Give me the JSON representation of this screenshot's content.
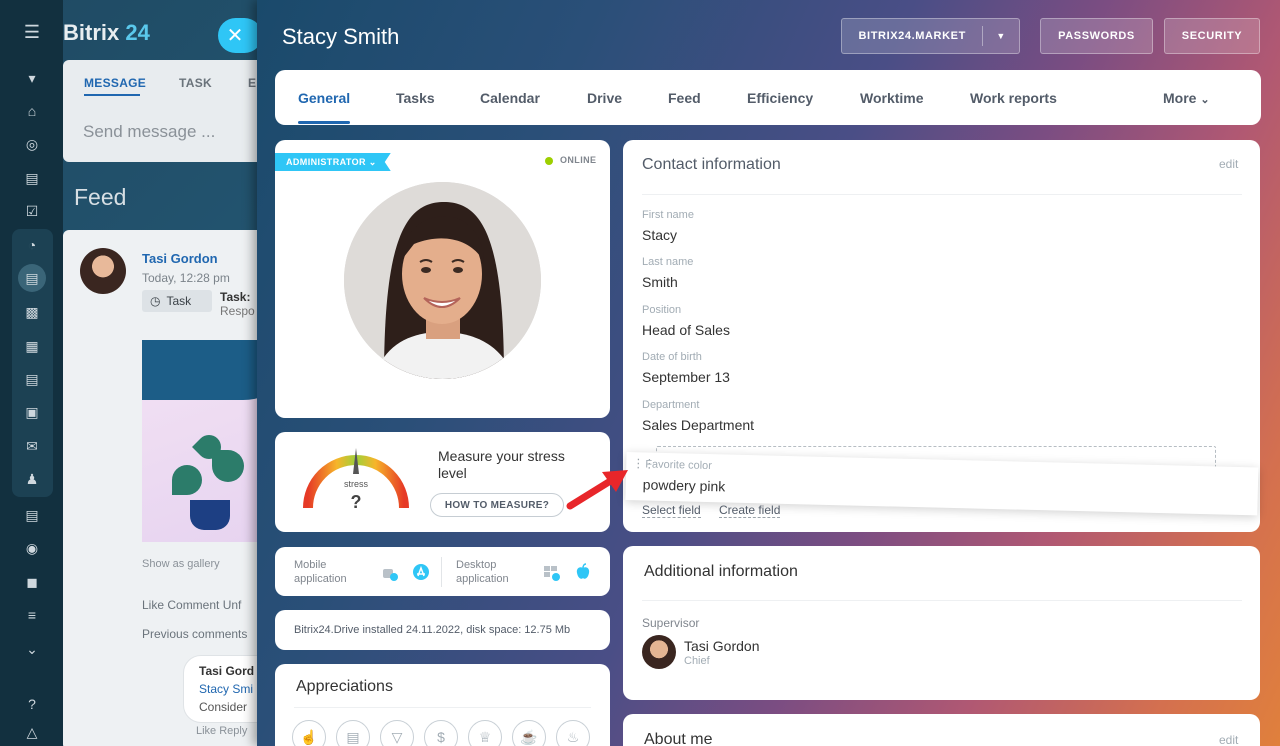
{
  "background": {
    "brand": {
      "name": "Bitrix",
      "num": "24"
    },
    "composer": {
      "tabs": [
        "MESSAGE",
        "TASK",
        "E"
      ],
      "placeholder": "Send message ..."
    },
    "feed_title": "Feed",
    "post": {
      "author": "Tasi Gordon",
      "time": "Today, 12:28 pm",
      "task_chip": "Task",
      "task_title": "Task:",
      "task_sub": "Respo",
      "show_gallery": "Show as gallery",
      "actions": "Like   Comment   Unf",
      "previous_comments": "Previous comments",
      "comment": {
        "author": "Tasi Gord",
        "link": "Stacy Smi",
        "text": "Consider"
      },
      "comment_actions": "Like   Reply"
    }
  },
  "profile": {
    "name": "Stacy Smith",
    "top_buttons": {
      "market": "BITRIX24.MARKET",
      "passwords": "PASSWORDS",
      "security": "SECURITY"
    },
    "tabs": [
      "General",
      "Tasks",
      "Calendar",
      "Drive",
      "Feed",
      "Efficiency",
      "Worktime",
      "Work reports",
      "More"
    ],
    "role_badge": "ADMINISTRATOR",
    "status": "ONLINE",
    "status_color": "#9dcf00",
    "stress": {
      "title": "Measure your stress level",
      "gauge_label": "stress",
      "gauge_value": "?",
      "button": "HOW TO MEASURE?"
    },
    "apps": {
      "mobile": "Mobile application",
      "desktop": "Desktop application"
    },
    "drive_info": "Bitrix24.Drive installed 24.11.2022, disk space: 12.75 Mb",
    "appreciations": {
      "title": "Appreciations"
    },
    "contact": {
      "title": "Contact information",
      "edit": "edit",
      "fields": [
        {
          "label": "First name",
          "value": "Stacy"
        },
        {
          "label": "Last name",
          "value": "Smith"
        },
        {
          "label": "Position",
          "value": "Head of Sales"
        },
        {
          "label": "Date of birth",
          "value": "September 13"
        },
        {
          "label": "Department",
          "value": "Sales Department"
        }
      ],
      "dragged_field": {
        "label": "Favorite color",
        "value": "powdery pink"
      },
      "select_field": "Select field",
      "create_field": "Create field"
    },
    "additional": {
      "title": "Additional information",
      "supervisor_label": "Supervisor",
      "supervisor_name": "Tasi Gordon",
      "supervisor_role": "Chief"
    },
    "about": {
      "title": "About me",
      "edit": "edit"
    }
  },
  "colors": {
    "accent": "#2067b0",
    "badge": "#2fc6f6",
    "annotation_arrow": "#e8262a"
  }
}
